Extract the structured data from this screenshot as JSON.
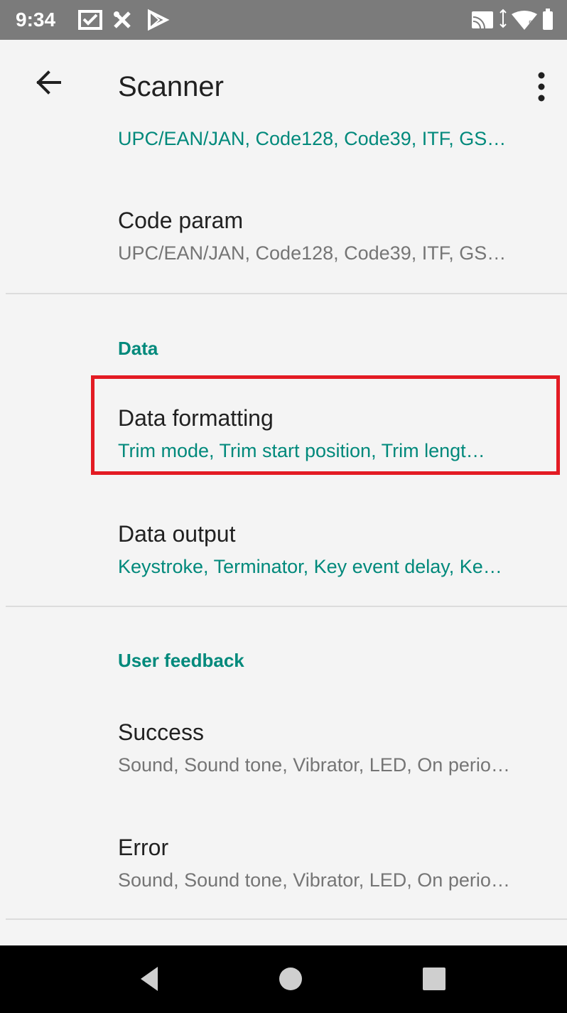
{
  "status_bar": {
    "time": "9:34",
    "left_icons": [
      "checkbox-icon",
      "tools-icon",
      "play-store-icon"
    ],
    "right_icons": [
      "cast-icon",
      "data-arrows-icon",
      "wifi-icon",
      "battery-icon"
    ]
  },
  "app_bar": {
    "title": "Scanner",
    "back_icon": "arrow-left-icon",
    "menu_icon": "more-vert-icon"
  },
  "items": {
    "partial_summary": "UPC/EAN/JAN, Code128, Code39, ITF, GS…",
    "code_param": {
      "title": "Code param",
      "summary": "UPC/EAN/JAN, Code128, Code39, ITF, GS…"
    },
    "data_header": "Data",
    "data_formatting": {
      "title": "Data formatting",
      "summary": "Trim mode, Trim start position, Trim lengt…"
    },
    "data_output": {
      "title": "Data output",
      "summary": "Keystroke, Terminator, Key event delay, Ke…"
    },
    "user_feedback_header": "User feedback",
    "success": {
      "title": "Success",
      "summary": "Sound, Sound tone, Vibrator, LED, On perio…"
    },
    "error": {
      "title": "Error",
      "summary": "Sound, Sound tone, Vibrator, LED, On perio…"
    }
  },
  "colors": {
    "accent": "#00897b",
    "highlight": "#e31b23",
    "status_bar": "#7b7b7b",
    "nav_bar": "#000000"
  },
  "nav_bar": {
    "icons": [
      "back-triangle-icon",
      "home-circle-icon",
      "recents-square-icon"
    ]
  }
}
